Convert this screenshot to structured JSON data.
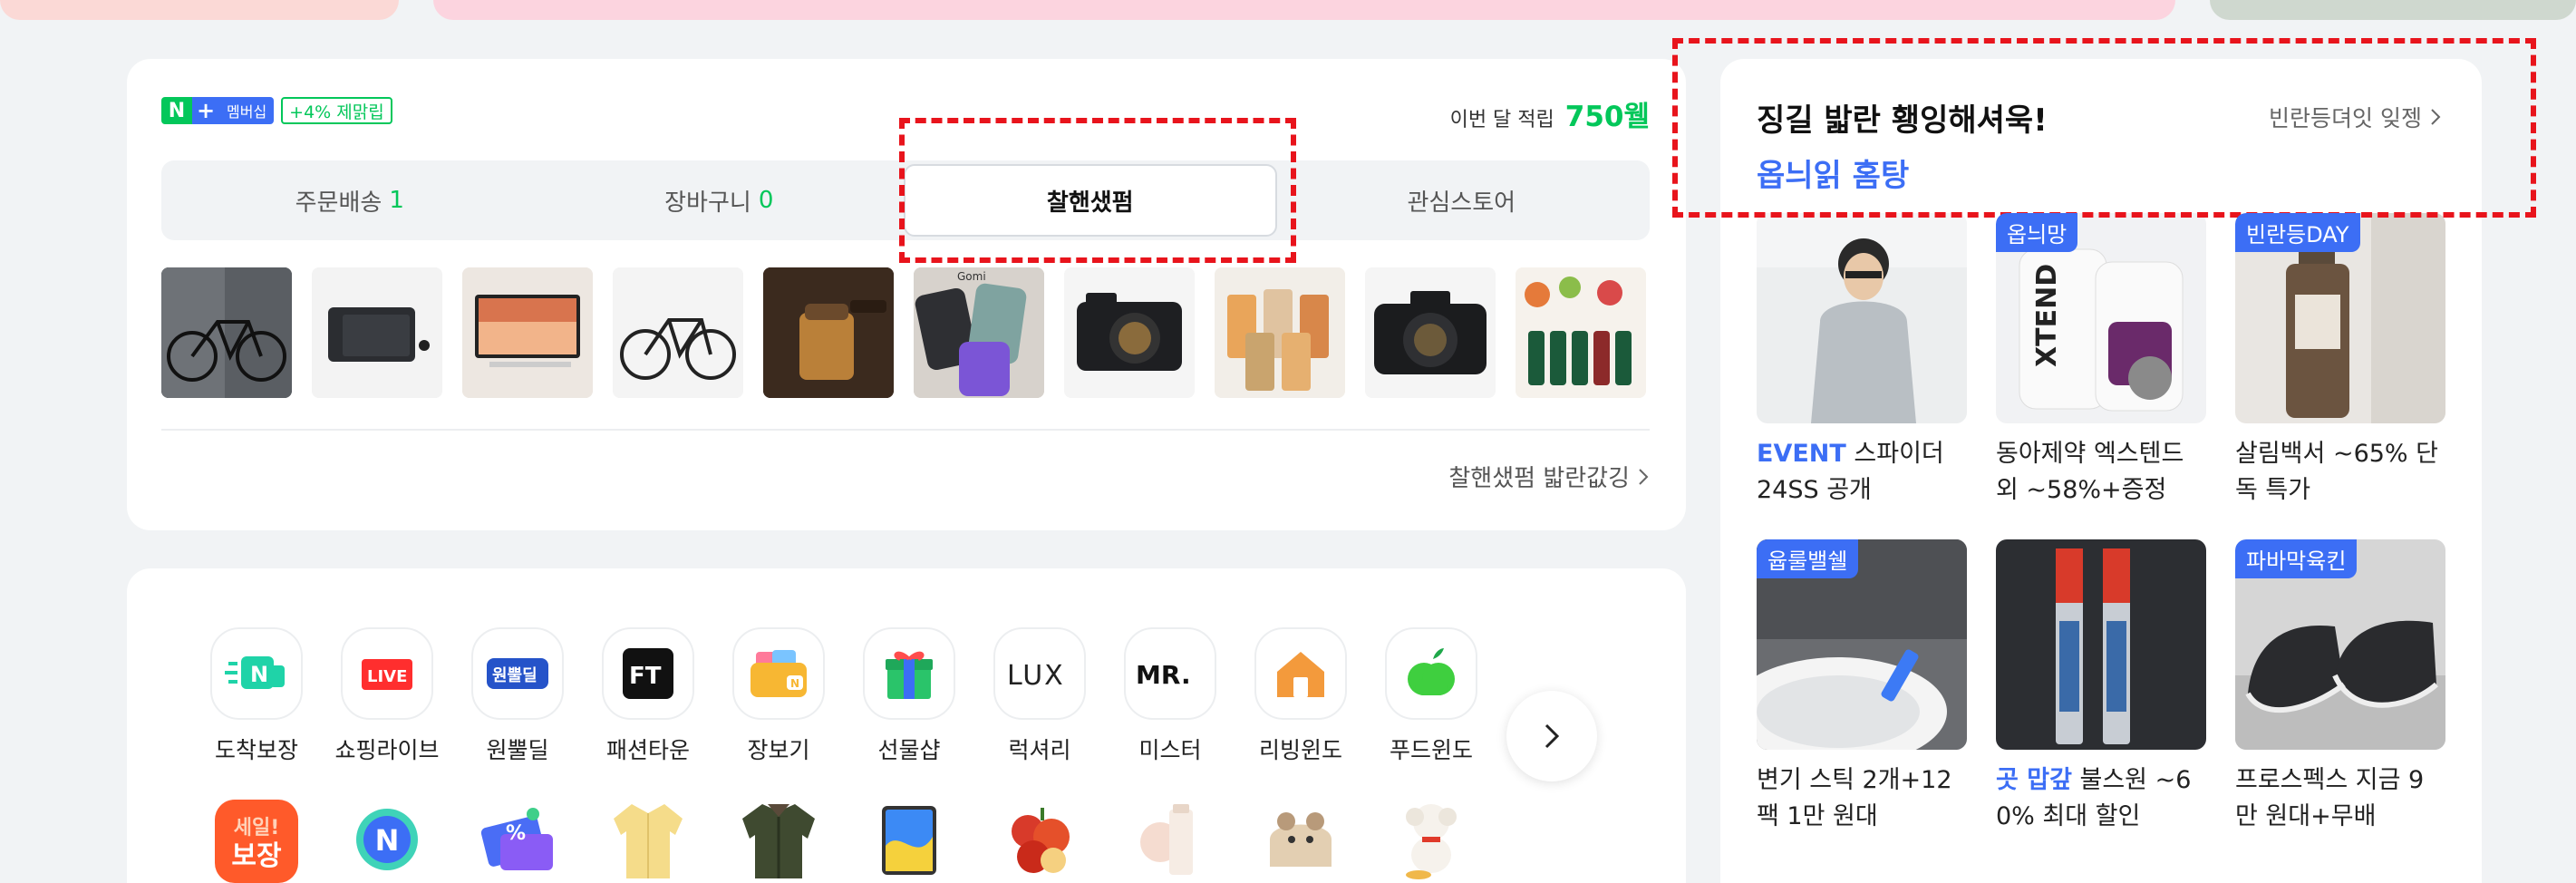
{
  "membership": {
    "badge_n": "N",
    "badge_plus": "+",
    "badge_member": "멤버십",
    "point_rate": "+4% 제맑립"
  },
  "month_points": {
    "label": "이번 달 적립",
    "value": "750웰"
  },
  "tabs": [
    {
      "label": "주문배송",
      "count": "1"
    },
    {
      "label": "장바구니",
      "count": "0"
    },
    {
      "label": "찰핸샜펌",
      "count": ""
    },
    {
      "label": "관심스토어",
      "count": ""
    }
  ],
  "products": [
    {
      "icon": "bicycle"
    },
    {
      "icon": "tablet"
    },
    {
      "icon": "monitor"
    },
    {
      "icon": "bicycle"
    },
    {
      "icon": "tea-cup",
      "overlay": ""
    },
    {
      "icon": "phones",
      "overlay": "Gomi"
    },
    {
      "icon": "camera"
    },
    {
      "icon": "juice-pouches"
    },
    {
      "icon": "camera"
    },
    {
      "icon": "drinks"
    }
  ],
  "shop_more": "찰핸샜펌 밟란값깅",
  "categories_row1": [
    {
      "label": "도착보장",
      "icon": "delivery-truck-icon"
    },
    {
      "label": "쇼핑라이브",
      "icon": "live-icon"
    },
    {
      "label": "원뿔딜",
      "icon": "one-plus-deal-icon"
    },
    {
      "label": "패션타운",
      "icon": "fashion-town-icon"
    },
    {
      "label": "장보기",
      "icon": "wallet-icon"
    },
    {
      "label": "선물샵",
      "icon": "gift-icon"
    },
    {
      "label": "럭셔리",
      "icon": "luxury-icon"
    },
    {
      "label": "미스터",
      "icon": "mister-icon"
    },
    {
      "label": "리빙윈도",
      "icon": "house-icon"
    },
    {
      "label": "푸드윈도",
      "icon": "apple-icon"
    }
  ],
  "categories_row2_icons": [
    "sale-guarantee-icon",
    "n-coin-icon",
    "coupon-icon",
    "cardigan-icon",
    "jacket-icon",
    "tablet-device-icon",
    "apples-icon",
    "cosmetic-icon",
    "hamster-icon",
    "puppy-icon"
  ],
  "categories_row2_badge": {
    "line1": "세일!",
    "line2": "보장"
  },
  "promo": {
    "title_line1": "징길 밟란 횅잉해셔욱!",
    "title_line2": "옵늬읽 홈탕",
    "more": "빈란등뎌잇 잊젱",
    "items": [
      {
        "tag": "",
        "highlight": "EVENT",
        "text": " 스파이더 24SS 공개"
      },
      {
        "tag": "옵늬망",
        "highlight": "",
        "text": "동아제약 엑스텐드 외 ~58%+증정"
      },
      {
        "tag": "빈란등DAY",
        "highlight": "",
        "text": "살림백서 ~65% 단독 특가"
      },
      {
        "tag": "윱룰밸쉘",
        "highlight": "",
        "text": "변기 스틱 2개+12팩 1만 원대"
      },
      {
        "tag": "",
        "highlight": "곳 맙갚",
        "text": " 불스원 ~60% 최대 할인"
      },
      {
        "tag": "파바막육킨",
        "highlight": "",
        "text": "프로스펙스 지금 9만 원대+무배"
      }
    ]
  },
  "colors": {
    "brand_green": "#03c75a",
    "accent_blue": "#3c6ef5",
    "highlight_red": "#e8141c"
  }
}
